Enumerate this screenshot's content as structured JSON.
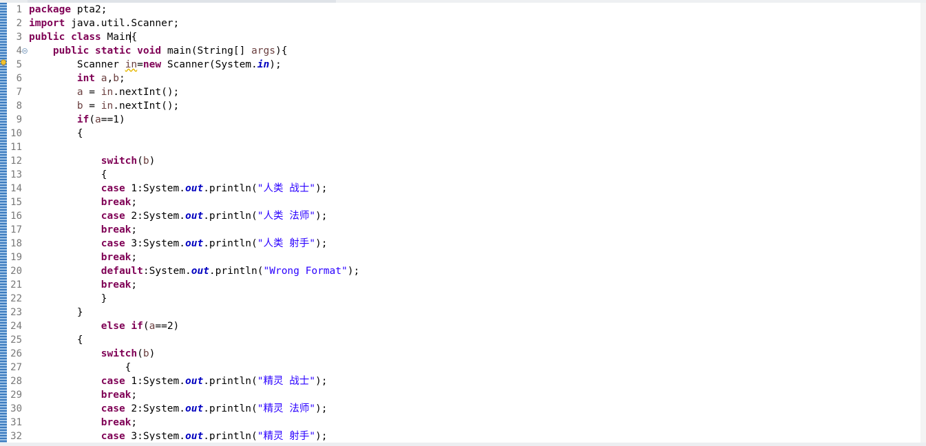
{
  "editor": {
    "line_numbers": [
      "1",
      "2",
      "3",
      "4",
      "5",
      "6",
      "7",
      "8",
      "9",
      "10",
      "11",
      "12",
      "13",
      "14",
      "15",
      "16",
      "17",
      "18",
      "19",
      "20",
      "21",
      "22",
      "23",
      "24",
      "25",
      "26",
      "27",
      "28",
      "29",
      "30",
      "31",
      "32"
    ],
    "lines": [
      [
        {
          "t": "package",
          "c": "kw"
        },
        {
          "t": " pta2;",
          "c": ""
        }
      ],
      [
        {
          "t": "import",
          "c": "kw"
        },
        {
          "t": " java.util.Scanner;",
          "c": ""
        }
      ],
      [
        {
          "t": "public",
          "c": "kw"
        },
        {
          "t": " ",
          "c": ""
        },
        {
          "t": "class",
          "c": "kw"
        },
        {
          "t": " Main",
          "c": ""
        },
        {
          "t": "{",
          "c": "cursor-brace"
        }
      ],
      [
        {
          "t": "    ",
          "c": ""
        },
        {
          "t": "public",
          "c": "kw"
        },
        {
          "t": " ",
          "c": ""
        },
        {
          "t": "static",
          "c": "kw"
        },
        {
          "t": " ",
          "c": ""
        },
        {
          "t": "void",
          "c": "kw"
        },
        {
          "t": " main(String[] ",
          "c": ""
        },
        {
          "t": "args",
          "c": "var"
        },
        {
          "t": "){",
          "c": ""
        }
      ],
      [
        {
          "t": "        Scanner ",
          "c": ""
        },
        {
          "t": "in",
          "c": "var warn"
        },
        {
          "t": "=",
          "c": ""
        },
        {
          "t": "new",
          "c": "kw"
        },
        {
          "t": " Scanner(System.",
          "c": ""
        },
        {
          "t": "in",
          "c": "fld"
        },
        {
          "t": ");",
          "c": ""
        }
      ],
      [
        {
          "t": "        ",
          "c": ""
        },
        {
          "t": "int",
          "c": "kw"
        },
        {
          "t": " ",
          "c": ""
        },
        {
          "t": "a",
          "c": "var"
        },
        {
          "t": ",",
          "c": ""
        },
        {
          "t": "b",
          "c": "var"
        },
        {
          "t": ";",
          "c": ""
        }
      ],
      [
        {
          "t": "        ",
          "c": ""
        },
        {
          "t": "a",
          "c": "var"
        },
        {
          "t": " = ",
          "c": ""
        },
        {
          "t": "in",
          "c": "var"
        },
        {
          "t": ".nextInt();",
          "c": ""
        }
      ],
      [
        {
          "t": "        ",
          "c": ""
        },
        {
          "t": "b",
          "c": "var"
        },
        {
          "t": " = ",
          "c": ""
        },
        {
          "t": "in",
          "c": "var"
        },
        {
          "t": ".nextInt();",
          "c": ""
        }
      ],
      [
        {
          "t": "        ",
          "c": ""
        },
        {
          "t": "if",
          "c": "kw"
        },
        {
          "t": "(",
          "c": ""
        },
        {
          "t": "a",
          "c": "var"
        },
        {
          "t": "==1)",
          "c": ""
        }
      ],
      [
        {
          "t": "        {",
          "c": ""
        }
      ],
      [
        {
          "t": "",
          "c": ""
        }
      ],
      [
        {
          "t": "            ",
          "c": ""
        },
        {
          "t": "switch",
          "c": "kw"
        },
        {
          "t": "(",
          "c": ""
        },
        {
          "t": "b",
          "c": "var"
        },
        {
          "t": ")",
          "c": ""
        }
      ],
      [
        {
          "t": "            {",
          "c": ""
        }
      ],
      [
        {
          "t": "            ",
          "c": ""
        },
        {
          "t": "case",
          "c": "kw"
        },
        {
          "t": " 1:System.",
          "c": ""
        },
        {
          "t": "out",
          "c": "fld"
        },
        {
          "t": ".println(",
          "c": ""
        },
        {
          "t": "\"人类 战士\"",
          "c": "str"
        },
        {
          "t": ");",
          "c": ""
        }
      ],
      [
        {
          "t": "            ",
          "c": ""
        },
        {
          "t": "break",
          "c": "kw"
        },
        {
          "t": ";",
          "c": ""
        }
      ],
      [
        {
          "t": "            ",
          "c": ""
        },
        {
          "t": "case",
          "c": "kw"
        },
        {
          "t": " 2:System.",
          "c": ""
        },
        {
          "t": "out",
          "c": "fld"
        },
        {
          "t": ".println(",
          "c": ""
        },
        {
          "t": "\"人类 法师\"",
          "c": "str"
        },
        {
          "t": ");",
          "c": ""
        }
      ],
      [
        {
          "t": "            ",
          "c": ""
        },
        {
          "t": "break",
          "c": "kw"
        },
        {
          "t": ";",
          "c": ""
        }
      ],
      [
        {
          "t": "            ",
          "c": ""
        },
        {
          "t": "case",
          "c": "kw"
        },
        {
          "t": " 3:System.",
          "c": ""
        },
        {
          "t": "out",
          "c": "fld"
        },
        {
          "t": ".println(",
          "c": ""
        },
        {
          "t": "\"人类 射手\"",
          "c": "str"
        },
        {
          "t": ");",
          "c": ""
        }
      ],
      [
        {
          "t": "            ",
          "c": ""
        },
        {
          "t": "break",
          "c": "kw"
        },
        {
          "t": ";",
          "c": ""
        }
      ],
      [
        {
          "t": "            ",
          "c": ""
        },
        {
          "t": "default",
          "c": "kw"
        },
        {
          "t": ":System.",
          "c": ""
        },
        {
          "t": "out",
          "c": "fld"
        },
        {
          "t": ".println(",
          "c": ""
        },
        {
          "t": "\"Wrong Format\"",
          "c": "str"
        },
        {
          "t": ");",
          "c": ""
        }
      ],
      [
        {
          "t": "            ",
          "c": ""
        },
        {
          "t": "break",
          "c": "kw"
        },
        {
          "t": ";",
          "c": ""
        }
      ],
      [
        {
          "t": "            }",
          "c": ""
        }
      ],
      [
        {
          "t": "        }",
          "c": ""
        }
      ],
      [
        {
          "t": "            ",
          "c": ""
        },
        {
          "t": "else",
          "c": "kw"
        },
        {
          "t": " ",
          "c": ""
        },
        {
          "t": "if",
          "c": "kw"
        },
        {
          "t": "(",
          "c": ""
        },
        {
          "t": "a",
          "c": "var"
        },
        {
          "t": "==2)",
          "c": ""
        }
      ],
      [
        {
          "t": "        {",
          "c": ""
        }
      ],
      [
        {
          "t": "            ",
          "c": ""
        },
        {
          "t": "switch",
          "c": "kw"
        },
        {
          "t": "(",
          "c": ""
        },
        {
          "t": "b",
          "c": "var"
        },
        {
          "t": ")",
          "c": ""
        }
      ],
      [
        {
          "t": "                {",
          "c": ""
        }
      ],
      [
        {
          "t": "            ",
          "c": ""
        },
        {
          "t": "case",
          "c": "kw"
        },
        {
          "t": " 1:System.",
          "c": ""
        },
        {
          "t": "out",
          "c": "fld"
        },
        {
          "t": ".println(",
          "c": ""
        },
        {
          "t": "\"精灵 战士\"",
          "c": "str"
        },
        {
          "t": ");",
          "c": ""
        }
      ],
      [
        {
          "t": "            ",
          "c": ""
        },
        {
          "t": "break",
          "c": "kw"
        },
        {
          "t": ";",
          "c": ""
        }
      ],
      [
        {
          "t": "            ",
          "c": ""
        },
        {
          "t": "case",
          "c": "kw"
        },
        {
          "t": " 2:System.",
          "c": ""
        },
        {
          "t": "out",
          "c": "fld"
        },
        {
          "t": ".println(",
          "c": ""
        },
        {
          "t": "\"精灵 法师\"",
          "c": "str"
        },
        {
          "t": ");",
          "c": ""
        }
      ],
      [
        {
          "t": "            ",
          "c": ""
        },
        {
          "t": "break",
          "c": "kw"
        },
        {
          "t": ";",
          "c": ""
        }
      ],
      [
        {
          "t": "            ",
          "c": ""
        },
        {
          "t": "case",
          "c": "kw"
        },
        {
          "t": " 3:System.",
          "c": ""
        },
        {
          "t": "out",
          "c": "fld"
        },
        {
          "t": ".println(",
          "c": ""
        },
        {
          "t": "\"精灵 射手\"",
          "c": "str"
        },
        {
          "t": ");",
          "c": ""
        }
      ]
    ]
  },
  "colors": {
    "keyword": "#7f0055",
    "string": "#2a00ff",
    "field": "#0000c0",
    "variable": "#6a3e3e",
    "line_number": "#787878"
  },
  "icons": {
    "fold": "collapse-minus-icon",
    "warning": "warning-lightbulb-icon"
  }
}
